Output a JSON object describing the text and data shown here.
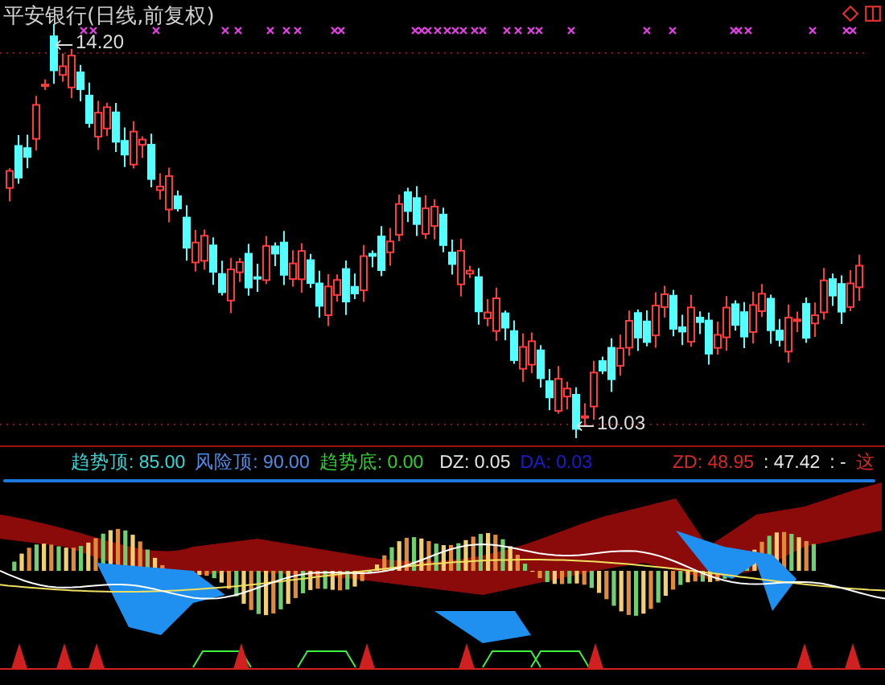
{
  "title": "平安银行(日线,前复权)",
  "price_chart": {
    "high_label": "14.20",
    "low_label": "10.03"
  },
  "legend": [
    {
      "text": "趋势顶: 85.00",
      "color": "#3ad6d6"
    },
    {
      "text": "风险顶: 90.00",
      "color": "#4f8ee8"
    },
    {
      "text": "趋势底: 0.00",
      "color": "#33cc33"
    },
    {
      "text": "DZ: 0.05",
      "color": "#e6e6e6"
    },
    {
      "text": "DA: 0.03",
      "color": "#1c1cd0"
    },
    {
      "text": "ZD: 48.95",
      "color": "#d42a2a"
    },
    {
      "text": ": 47.42",
      "color": "#e6e6e6"
    },
    {
      "text": ": -",
      "color": "#e6e6e6"
    },
    {
      "text": "这",
      "color": "#d42a2a"
    }
  ]
}
